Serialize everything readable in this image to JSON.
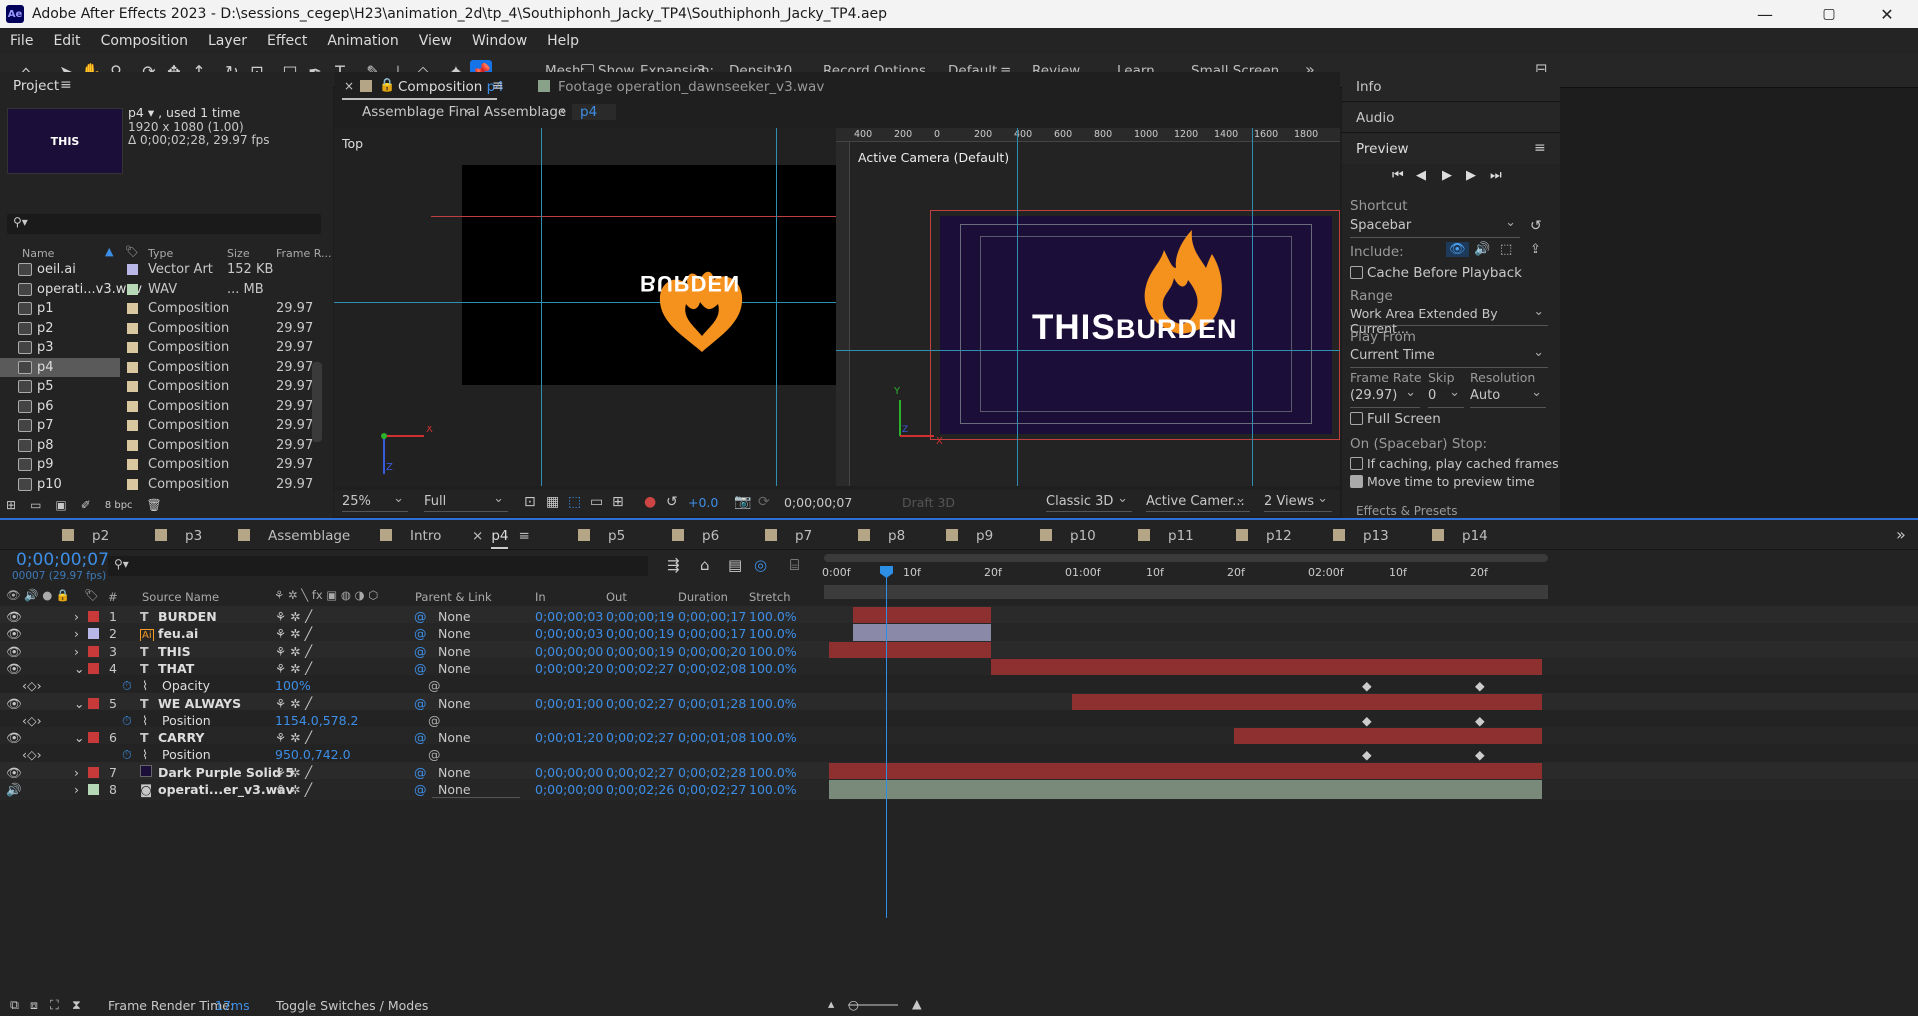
{
  "window": {
    "app_label": "Ae",
    "title": "Adobe After Effects 2023 - D:\\sessions_cegep\\H23\\animation_2d\\tp_4\\Southiphonh_Jacky_TP4\\Southiphonh_Jacky_TP4.aep",
    "minimize": "—",
    "maximize": "▢",
    "close": "✕"
  },
  "menu": [
    "File",
    "Edit",
    "Composition",
    "Layer",
    "Effect",
    "Animation",
    "View",
    "Window",
    "Help"
  ],
  "toolbar": {
    "mesh_label": "Mesh:",
    "show_label": "Show",
    "expansion_label": "Expansion:",
    "expansion_value": "3",
    "density_label": "Density:",
    "density_value": "10",
    "record_options": "Record Options",
    "workspaces": [
      "Default",
      "Review",
      "Learn",
      "Small Screen"
    ],
    "more": "»"
  },
  "project": {
    "title": "Project",
    "thumb_text": "THIS",
    "comp_name": "p4 ▾ , used 1 time",
    "comp_size": "1920 x 1080 (1.00)",
    "comp_dur": "Δ 0;00;02;28, 29.97 fps",
    "cols": {
      "name": "Name",
      "type": "Type",
      "size": "Size",
      "fr": "Frame R..."
    },
    "items": [
      {
        "name": "oeil.ai",
        "type": "Vector Art",
        "size": "152 KB",
        "fr": "",
        "color": "#b8b7e8"
      },
      {
        "name": "operati...v3.wav",
        "type": "WAV",
        "size": "... MB",
        "fr": "",
        "color": "#b7d8b7"
      },
      {
        "name": "p1",
        "type": "Composition",
        "size": "",
        "fr": "29.97",
        "color": "#d8c79f"
      },
      {
        "name": "p2",
        "type": "Composition",
        "size": "",
        "fr": "29.97",
        "color": "#d8c79f"
      },
      {
        "name": "p3",
        "type": "Composition",
        "size": "",
        "fr": "29.97",
        "color": "#d8c79f"
      },
      {
        "name": "p4",
        "type": "Composition",
        "size": "",
        "fr": "29.97",
        "color": "#d8c79f"
      },
      {
        "name": "p5",
        "type": "Composition",
        "size": "",
        "fr": "29.97",
        "color": "#d8c79f"
      },
      {
        "name": "p6",
        "type": "Composition",
        "size": "",
        "fr": "29.97",
        "color": "#d8c79f"
      },
      {
        "name": "p7",
        "type": "Composition",
        "size": "",
        "fr": "29.97",
        "color": "#d8c79f"
      },
      {
        "name": "p8",
        "type": "Composition",
        "size": "",
        "fr": "29.97",
        "color": "#d8c79f"
      },
      {
        "name": "p9",
        "type": "Composition",
        "size": "",
        "fr": "29.97",
        "color": "#d8c79f"
      },
      {
        "name": "p10",
        "type": "Composition",
        "size": "",
        "fr": "29.97",
        "color": "#d8c79f"
      }
    ],
    "bpc": "8 bpc"
  },
  "viewer": {
    "tab_comp": "Composition",
    "tab_comp_name": "p4",
    "tab_footage": "Footage  operation_dawnseeker_v3.wav",
    "breadcrumbs": [
      "Assemblage Final",
      "Assemblage",
      "p4"
    ],
    "left_view_label": "Top",
    "right_view_label": "Active Camera (Default)",
    "burden_text": "BURDEN",
    "this_text": "THIS",
    "burden2_text": "BURDEN",
    "ruler": [
      "400",
      "200",
      "0",
      "200",
      "400",
      "600",
      "800",
      "1000",
      "1200",
      "1400",
      "1600",
      "1800"
    ],
    "zoom": "25%",
    "res": "Full",
    "exposure": "+0.0",
    "timecode": "0;00;00;07",
    "draft3d": "Draft 3D",
    "renderer": "Classic 3D",
    "camera": "Active Camer...",
    "views": "2 Views"
  },
  "right_panel": {
    "info": "Info",
    "audio": "Audio",
    "preview": "Preview",
    "shortcut_label": "Shortcut",
    "shortcut": "Spacebar",
    "include_label": "Include:",
    "cache_before": "Cache Before Playback",
    "range_label": "Range",
    "range": "Work Area Extended By Current...",
    "play_from_label": "Play From",
    "play_from": "Current Time",
    "frame_rate_label": "Frame Rate",
    "skip_label": "Skip",
    "resolution_label": "Resolution",
    "frame_rate": "(29.97)",
    "skip": "0",
    "resolution": "Auto",
    "full_screen": "Full Screen",
    "on_stop": "On (Spacebar) Stop:",
    "if_caching": "If caching, play cached frames",
    "move_time": "Move time to preview time",
    "effects_presets": "Effects & Presets"
  },
  "timeline": {
    "tabs": [
      "p2",
      "p3",
      "Assemblage",
      "Intro",
      "p4",
      "p5",
      "p6",
      "p7",
      "p8",
      "p9",
      "p10",
      "p11",
      "p12",
      "p13",
      "p14"
    ],
    "timecode": "0;00;00;07",
    "frames": "00007 (29.97 fps)",
    "cols": {
      "num": "#",
      "source": "Source Name",
      "parent": "Parent & Link",
      "in": "In",
      "out": "Out",
      "dur": "Duration",
      "stretch": "Stretch"
    },
    "ruler": [
      "0:00f",
      "10f",
      "20f",
      "01:00f",
      "10f",
      "20f",
      "02:00f",
      "10f",
      "20f"
    ],
    "layers": [
      {
        "num": "1",
        "kind": "T",
        "name": "BURDEN",
        "parent": "None",
        "in": "0;00;00;03",
        "out": "0;00;00;19",
        "dur": "0;00;00;17",
        "stretch": "100.0%",
        "color": "#c83a3a",
        "bar_in": 3,
        "bar_out": 19,
        "bar_color": "#8e3030"
      },
      {
        "num": "2",
        "kind": "Ai",
        "name": "feu.ai",
        "parent": "None",
        "in": "0;00;00;03",
        "out": "0;00;00;19",
        "dur": "0;00;00;17",
        "stretch": "100.0%",
        "color": "#b8b7e8",
        "bar_in": 3,
        "bar_out": 19,
        "bar_color": "#8a8aa8"
      },
      {
        "num": "3",
        "kind": "T",
        "name": "THIS",
        "parent": "None",
        "in": "0;00;00;00",
        "out": "0;00;00;19",
        "dur": "0;00;00;20",
        "stretch": "100.0%",
        "color": "#c83a3a",
        "bar_in": 0,
        "bar_out": 19,
        "bar_color": "#8e3030"
      },
      {
        "num": "4",
        "kind": "T",
        "name": "THAT",
        "parent": "None",
        "in": "0;00;00;20",
        "out": "0;00;02;27",
        "dur": "0;00;02;08",
        "stretch": "100.0%",
        "color": "#c83a3a",
        "bar_in": 20,
        "bar_out": 88,
        "bar_color": "#8e3030",
        "prop": {
          "name": "Opacity",
          "value": "100%"
        }
      },
      {
        "num": "5",
        "kind": "T",
        "name": "WE  ALWAYS",
        "parent": "None",
        "in": "0;00;01;00",
        "out": "0;00;02;27",
        "dur": "0;00;01;28",
        "stretch": "100.0%",
        "color": "#c83a3a",
        "bar_in": 30,
        "bar_out": 88,
        "bar_color": "#8e3030",
        "prop": {
          "name": "Position",
          "value": "1154.0,578.2"
        }
      },
      {
        "num": "6",
        "kind": "T",
        "name": "CARRY",
        "parent": "None",
        "in": "0;00;01;20",
        "out": "0;00;02;27",
        "dur": "0;00;01;08",
        "stretch": "100.0%",
        "color": "#c83a3a",
        "bar_in": 50,
        "bar_out": 88,
        "bar_color": "#8e3030",
        "prop": {
          "name": "Position",
          "value": "950.0,742.0"
        }
      },
      {
        "num": "7",
        "kind": "S",
        "name": "Dark Purple Solid 5",
        "parent": "None",
        "in": "0;00;00;00",
        "out": "0;00;02;27",
        "dur": "0;00;02;28",
        "stretch": "100.0%",
        "color": "#c83a3a",
        "bar_in": 0,
        "bar_out": 88,
        "bar_color": "#8e3030"
      },
      {
        "num": "8",
        "kind": "W",
        "name": "operati...er_v3.wav",
        "parent": "None",
        "in": "0;00;00;00",
        "out": "0;00;02;26",
        "dur": "0;00;02;27",
        "stretch": "100.0%",
        "color": "#b7d8b7",
        "bar_in": 0,
        "bar_out": 87,
        "bar_color": "#7a8a7a"
      }
    ],
    "footer_render_label": "Frame Render Time:",
    "footer_render_value": "17ms",
    "toggle": "Toggle Switches / Modes"
  }
}
